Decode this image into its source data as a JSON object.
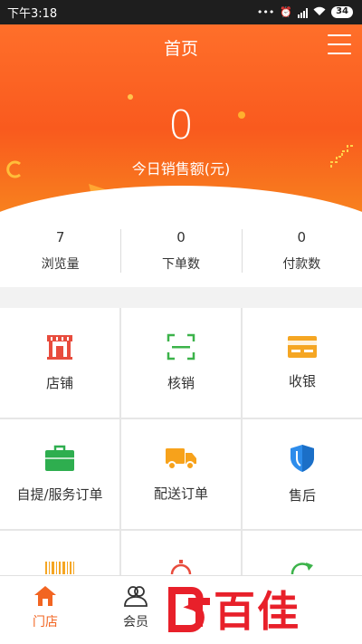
{
  "status_bar": {
    "time": "下午3:18",
    "signal": "HD",
    "battery": "34"
  },
  "header": {
    "title": "首页"
  },
  "sales": {
    "value": "0",
    "label": "今日销售额(元)"
  },
  "stats": [
    {
      "value": "7",
      "label": "浏览量"
    },
    {
      "value": "0",
      "label": "下单数"
    },
    {
      "value": "0",
      "label": "付款数"
    }
  ],
  "grid": [
    {
      "label": "店铺",
      "icon": "store-icon",
      "color": "#e84c3d"
    },
    {
      "label": "核销",
      "icon": "scan-icon",
      "color": "#3cb34a"
    },
    {
      "label": "收银",
      "icon": "card-icon",
      "color": "#f5a623"
    },
    {
      "label": "自提/服务订单",
      "icon": "briefcase-icon",
      "color": "#2eae4f"
    },
    {
      "label": "配送订单",
      "icon": "truck-icon",
      "color": "#f7a21b"
    },
    {
      "label": "售后",
      "icon": "shield-icon",
      "color": "#2d8ceb"
    },
    {
      "label": "",
      "icon": "barcode-icon",
      "color": "#f5a623"
    },
    {
      "label": "",
      "icon": "clock-icon",
      "color": "#e84c3d"
    },
    {
      "label": "",
      "icon": "refresh-icon",
      "color": "#3cb34a"
    }
  ],
  "tabs": [
    {
      "label": "门店",
      "icon": "home-icon",
      "active": true
    },
    {
      "label": "会员",
      "icon": "members-icon",
      "active": false
    }
  ],
  "watermark": {
    "text": "百佳"
  },
  "colors": {
    "accent": "#f26522",
    "hero_top": "#ff6f2a",
    "hero_bottom": "#f8821e"
  }
}
